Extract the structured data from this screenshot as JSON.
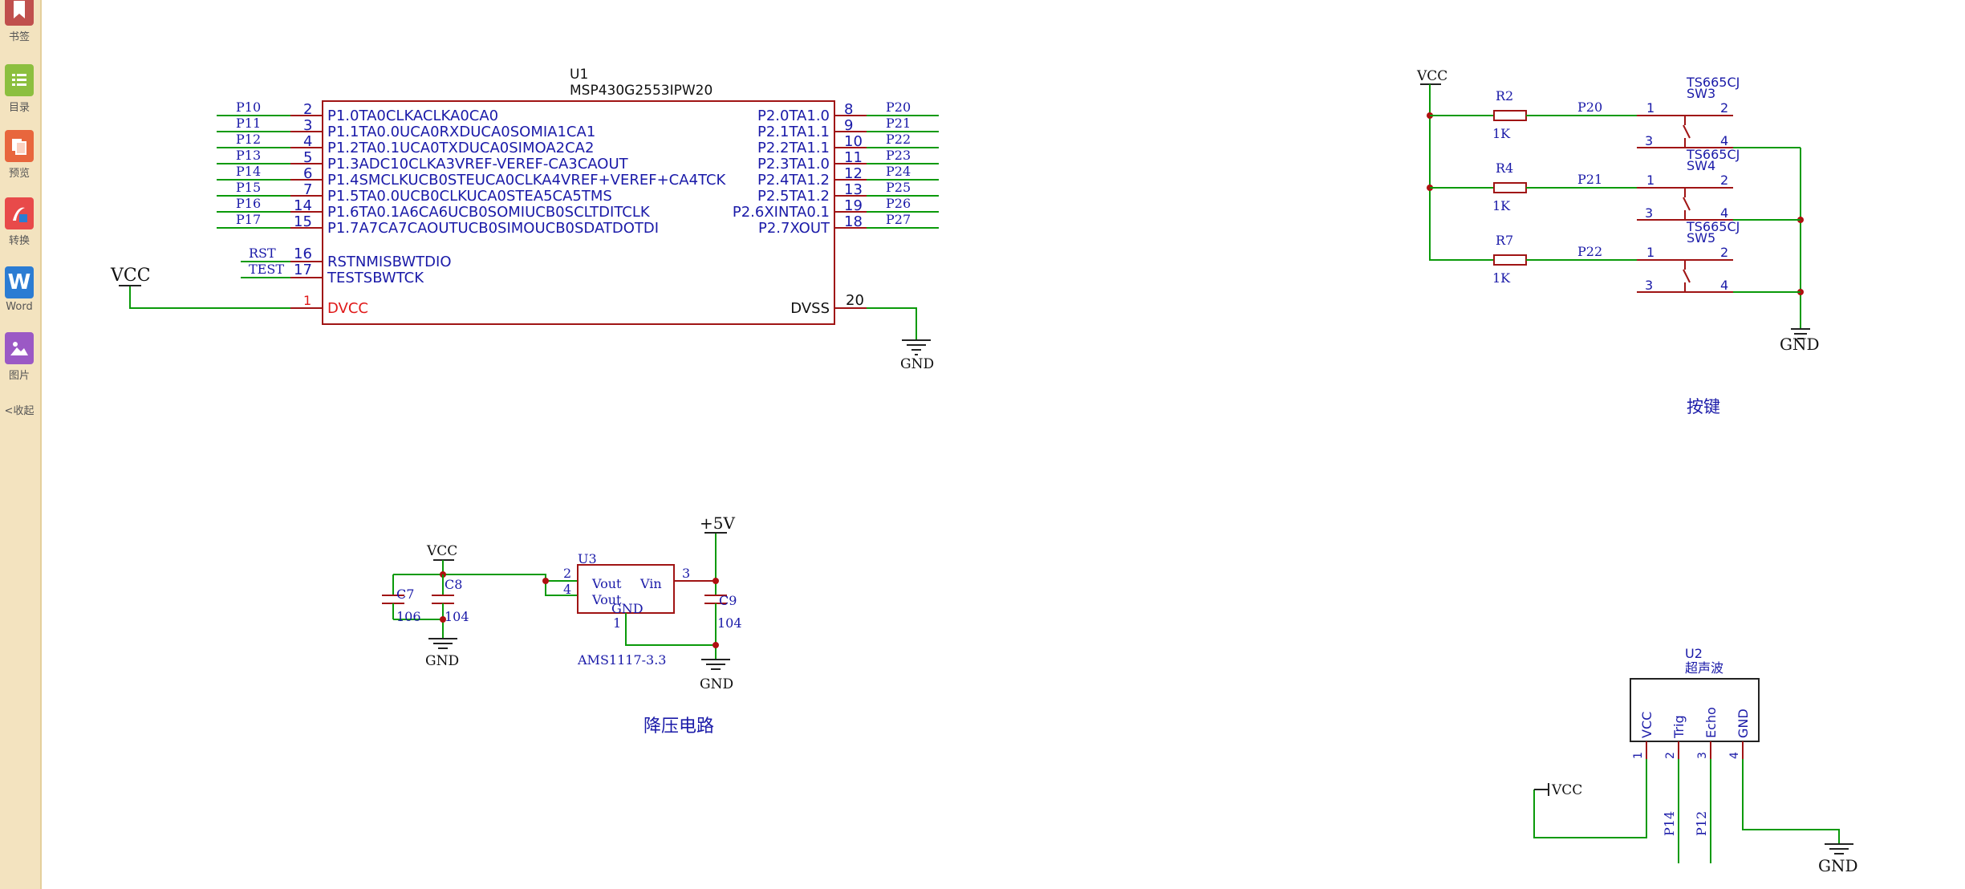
{
  "sidebar": {
    "items": [
      {
        "label": "书签",
        "icon": "bookmark-icon",
        "color": "#c0504d"
      },
      {
        "label": "目录",
        "icon": "list-icon",
        "color": "#8cbf3f"
      },
      {
        "label": "预览",
        "icon": "preview-icon",
        "color": "#e8663d"
      },
      {
        "label": "转换",
        "icon": "pdf-convert-icon",
        "color": "#e84a4a"
      },
      {
        "label": "Word",
        "icon": "word-icon",
        "glyph": "W",
        "color": "#2b7cd3"
      },
      {
        "label": "图片",
        "icon": "image-icon",
        "color": "#9b59c5"
      }
    ],
    "collapse_label": "收起"
  },
  "mcu": {
    "ref": "U1",
    "part": "MSP430G2553IPW20",
    "left_pins": [
      {
        "net": "P10",
        "num": "2",
        "name": "P1.0TA0CLKACLKA0CA0"
      },
      {
        "net": "P11",
        "num": "3",
        "name": "P1.1TA0.0UCA0RXDUCA0SOMIA1CA1"
      },
      {
        "net": "P12",
        "num": "4",
        "name": "P1.2TA0.1UCA0TXDUCA0SIMOA2CA2"
      },
      {
        "net": "P13",
        "num": "5",
        "name": "P1.3ADC10CLKA3VREF-VEREF-CA3CAOUT"
      },
      {
        "net": "P14",
        "num": "6",
        "name": "P1.4SMCLKUCB0STEUCA0CLKA4VREF+VEREF+CA4TCK"
      },
      {
        "net": "P15",
        "num": "7",
        "name": "P1.5TA0.0UCB0CLKUCA0STEA5CA5TMS"
      },
      {
        "net": "P16",
        "num": "14",
        "name": "P1.6TA0.1A6CA6UCB0SOMIUCB0SCLTDITCLK"
      },
      {
        "net": "P17",
        "num": "15",
        "name": "P1.7A7CA7CAOUTUCB0SIMOUCB0SDATDOTDI"
      }
    ],
    "right_pins": [
      {
        "net": "P20",
        "num": "8",
        "name": "P2.0TA1.0"
      },
      {
        "net": "P21",
        "num": "9",
        "name": "P2.1TA1.1"
      },
      {
        "net": "P22",
        "num": "10",
        "name": "P2.2TA1.1"
      },
      {
        "net": "P23",
        "num": "11",
        "name": "P2.3TA1.0"
      },
      {
        "net": "P24",
        "num": "12",
        "name": "P2.4TA1.2"
      },
      {
        "net": "P25",
        "num": "13",
        "name": "P2.5TA1.2"
      },
      {
        "net": "P26",
        "num": "19",
        "name": "P2.6XINTA0.1"
      },
      {
        "net": "P27",
        "num": "18",
        "name": "P2.7XOUT"
      }
    ],
    "rst": {
      "net": "RST",
      "num": "16",
      "name": "RSTNMISBWTDIO"
    },
    "test": {
      "net": "TEST",
      "num": "17",
      "name": "TESTSBWTCK"
    },
    "dvcc": {
      "num": "1",
      "name": "DVCC"
    },
    "dvss": {
      "num": "20",
      "name": "DVSS"
    },
    "vcc": "VCC",
    "gnd": "GND"
  },
  "buttons": {
    "vcc": "VCC",
    "gnd": "GND",
    "title": "按键",
    "rows": [
      {
        "res": "R2",
        "val": "1K",
        "net": "P20",
        "sw": "SW3",
        "part": "TS665CJ"
      },
      {
        "res": "R4",
        "val": "1K",
        "net": "P21",
        "sw": "SW4",
        "part": "TS665CJ"
      },
      {
        "res": "R7",
        "val": "1K",
        "net": "P22",
        "sw": "SW5",
        "part": "TS665CJ"
      }
    ],
    "pins": {
      "p1": "1",
      "p2": "2",
      "p3": "3",
      "p4": "4"
    }
  },
  "regulator": {
    "title": "降压电路",
    "ref": "U3",
    "part": "AMS1117-3.3",
    "vout1": "Vout",
    "vout2": "Vout",
    "vin": "Vin",
    "gnd_pin": "GND",
    "pin2": "2",
    "pin4": "4",
    "pin3": "3",
    "pin1": "1",
    "plus5v": "+5V",
    "vcc": "VCC",
    "c7": "C7",
    "c7_val": "106",
    "c8": "C8",
    "c8_val": "104",
    "c9": "C9",
    "c9_val": "104",
    "gnd_left": "GND",
    "gnd_right": "GND"
  },
  "ultrasonic": {
    "ref": "U2",
    "part": "超声波",
    "pins": [
      {
        "num": "1",
        "name": "VCC"
      },
      {
        "num": "2",
        "name": "Trig"
      },
      {
        "num": "3",
        "name": "Echo"
      },
      {
        "num": "4",
        "name": "GND"
      }
    ],
    "vcc": "VCC",
    "gnd": "GND",
    "net_trig": "P14",
    "net_echo": "P12"
  }
}
